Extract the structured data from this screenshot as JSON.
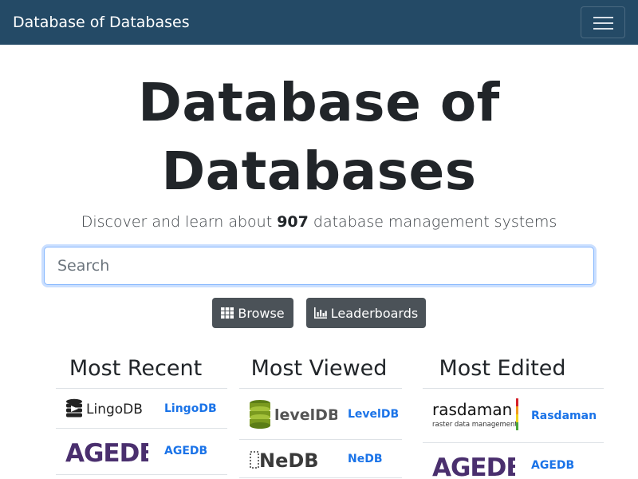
{
  "navbar": {
    "brand": "Database of Databases",
    "toggler_icon": "hamburger-menu-icon"
  },
  "hero": {
    "title_line1": "Database of",
    "title_line2": "Databases",
    "lead_before": "Discover and learn about ",
    "lead_count": "907",
    "lead_after": " database management systems"
  },
  "search": {
    "placeholder": "Search",
    "value": ""
  },
  "buttons": {
    "browse_icon": "grid-icon",
    "browse": "Browse",
    "leaderboards_icon": "bar-chart-icon",
    "leaderboards": "Leaderboards"
  },
  "sections": {
    "most_recent": {
      "title": "Most Recent",
      "items": [
        {
          "logo_text": "LingoDB",
          "name": "LingoDB"
        },
        {
          "logo_text": "AGEDB",
          "name": "AGEDB"
        }
      ]
    },
    "most_viewed": {
      "title": "Most Viewed",
      "items": [
        {
          "logo_text": "levelDB",
          "name": "LevelDB"
        },
        {
          "logo_text": "NeDB",
          "name": "NeDB"
        }
      ]
    },
    "most_edited": {
      "title": "Most Edited",
      "items": [
        {
          "logo_text": "rasdaman",
          "logo_subtext": "raster data management",
          "name": "Rasdaman"
        },
        {
          "logo_text": "AGEDB",
          "name": "AGEDB"
        }
      ]
    }
  },
  "colors": {
    "navbar": "#244a66",
    "link": "#1a73e8",
    "button": "#4b5258",
    "agedb_purple": "#4a2f6e",
    "agedb_magenta": "#b5336a",
    "leveldb_green": "#7a9a1f"
  }
}
